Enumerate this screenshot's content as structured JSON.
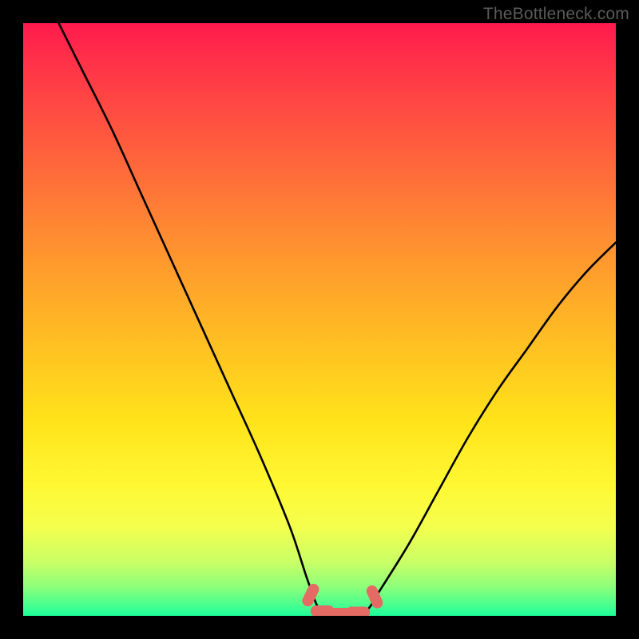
{
  "watermark": "TheBottleneck.com",
  "chart_data": {
    "type": "line",
    "title": "",
    "xlabel": "",
    "ylabel": "",
    "xlim": [
      0,
      100
    ],
    "ylim": [
      0,
      100
    ],
    "series": [
      {
        "name": "bottleneck-curve",
        "x": [
          6,
          10,
          15,
          20,
          25,
          30,
          35,
          40,
          45,
          48,
          50,
          52,
          55,
          58,
          60,
          65,
          70,
          75,
          80,
          85,
          90,
          95,
          100
        ],
        "values": [
          100,
          92,
          82,
          71,
          60,
          49,
          38,
          27,
          15,
          6,
          1,
          0,
          0,
          1,
          4,
          12,
          21,
          30,
          38,
          45,
          52,
          58,
          63
        ]
      }
    ],
    "markers": [
      {
        "name": "minimum-marker-left",
        "x": 48.5,
        "y": 3.5,
        "color": "#e46a64"
      },
      {
        "name": "minimum-marker-flat1",
        "x": 50.5,
        "y": 0.8,
        "color": "#e46a64"
      },
      {
        "name": "minimum-marker-flat2",
        "x": 53.5,
        "y": 0.4,
        "color": "#e46a64"
      },
      {
        "name": "minimum-marker-flat3",
        "x": 56.5,
        "y": 0.6,
        "color": "#e46a64"
      },
      {
        "name": "minimum-marker-right",
        "x": 59.3,
        "y": 3.2,
        "color": "#e46a64"
      }
    ],
    "background_gradient": {
      "top": "#ff1a4d",
      "mid": "#ffe31a",
      "bottom": "#1aff99"
    }
  }
}
